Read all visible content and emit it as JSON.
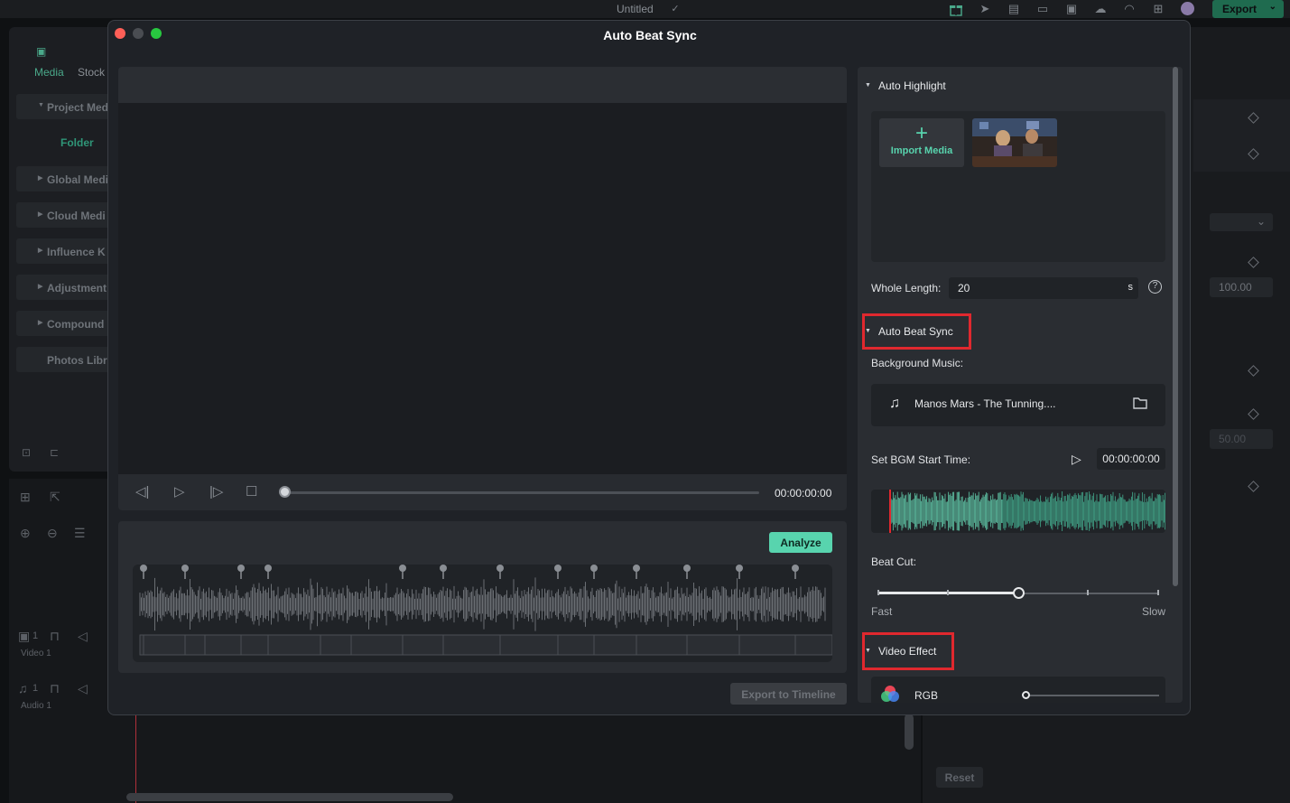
{
  "app": {
    "title": "Untitled",
    "export_label": "Export",
    "left_tabs": [
      "Media",
      "Stock"
    ],
    "left_items": [
      "Project Med",
      "Global Medi",
      "Cloud Medi",
      "Influence K",
      "Adjustment",
      "Compound",
      "Photos Libr"
    ],
    "folder_label": "Folder",
    "tracks": [
      {
        "badge": "1",
        "label": "Video 1"
      },
      {
        "badge": "1",
        "label": "Audio 1"
      }
    ],
    "right_values": [
      "100.00",
      "50.00"
    ],
    "reset_label": "Reset"
  },
  "modal": {
    "title": "Auto Beat Sync",
    "player_time": "00:00:00:00",
    "analyze_label": "Analyze",
    "export_to_timeline": "Export to Timeline",
    "auto_highlight": {
      "title": "Auto Highlight",
      "import_label": "Import Media",
      "whole_length_label": "Whole Length:",
      "whole_length_value": "20",
      "whole_length_unit": "s"
    },
    "auto_beat_sync": {
      "title": "Auto Beat Sync",
      "background_music_label": "Background Music:",
      "music_name": "Manos Mars - The Tunning....",
      "bgm_start_label": "Set BGM Start Time:",
      "bgm_start_time": "00:00:00:00",
      "beat_cut_label": "Beat Cut:",
      "beat_cut_min": "Fast",
      "beat_cut_max": "Slow",
      "beat_cut_level": 0.5
    },
    "video_effect": {
      "title": "Video Effect",
      "effect_name": "RGB"
    }
  },
  "colors": {
    "accent": "#58d4ae",
    "highlight_box": "#e0282e",
    "close": "#fe5f57",
    "minimize": "#4a4d52",
    "zoom": "#28c840"
  },
  "icons": [
    "gift-icon",
    "send-icon",
    "page-icon",
    "layout-icon",
    "save-icon",
    "cloud-upload-icon",
    "headset-icon",
    "grid-icon",
    "avatar",
    "music-note-icon",
    "folder-icon",
    "play-icon",
    "help-icon",
    "plus-icon"
  ]
}
